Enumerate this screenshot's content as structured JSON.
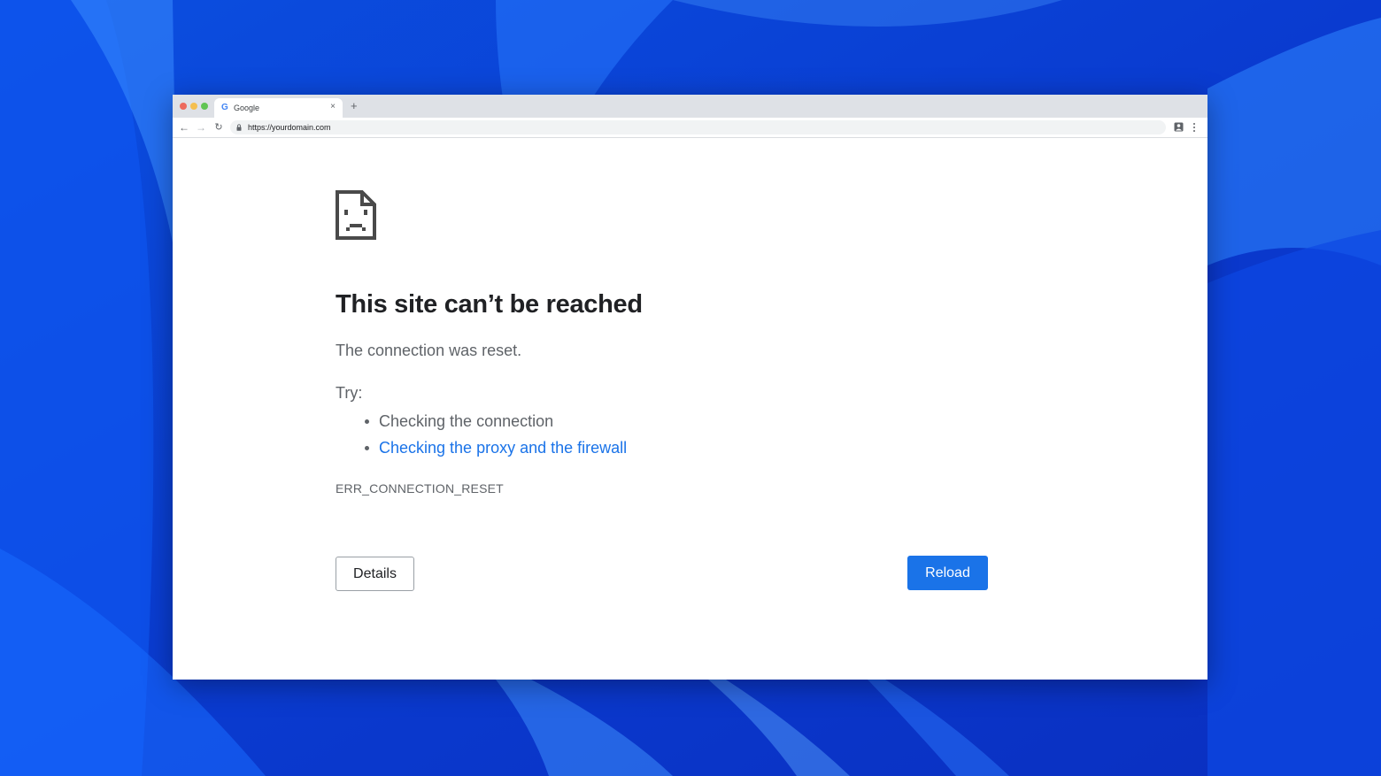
{
  "tab": {
    "title": "Google",
    "favicon": "G",
    "close": "×",
    "new_tab": "+"
  },
  "toolbar": {
    "back": "←",
    "forward": "→",
    "reload": "↻",
    "url": "https://yourdomain.com"
  },
  "error": {
    "headline": "This site can’t be reached",
    "subtitle": "The connection was reset.",
    "try_label": "Try:",
    "suggestions": [
      "Checking the connection",
      "Checking the proxy and the firewall"
    ],
    "code": "ERR_CONNECTION_RESET"
  },
  "buttons": {
    "details": "Details",
    "reload": "Reload"
  },
  "colors": {
    "accent": "#1a73e8",
    "wallpaper": "#0a3fd6",
    "text_secondary": "#5f6368"
  }
}
